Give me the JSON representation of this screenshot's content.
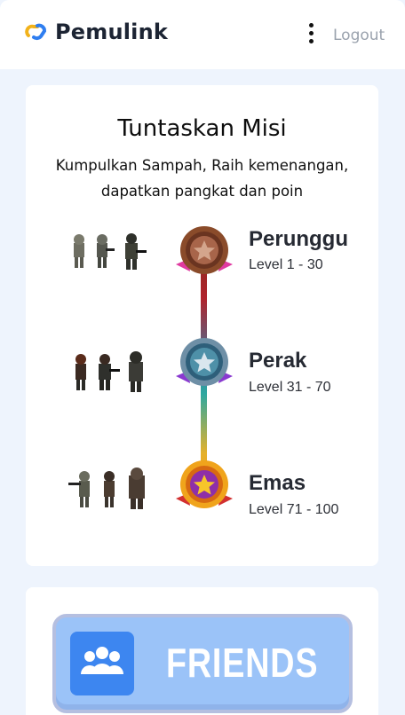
{
  "header": {
    "brand": "Pemulink",
    "logout_label": "Logout"
  },
  "mission": {
    "title": "Tuntaskan Misi",
    "subtitle_line1": "Kumpulkan Sampah, Raih kemenangan,",
    "subtitle_line2": "dapatkan pangkat dan poin",
    "tiers": [
      {
        "name": "Perunggu",
        "range": "Level 1 - 30",
        "color": "#8a4b2a",
        "ribbon": "#e03aa0"
      },
      {
        "name": "Perak",
        "range": "Level 31 - 70",
        "color": "#6e8fa6",
        "ribbon": "#8a3ad0"
      },
      {
        "name": "Emas",
        "range": "Level 71 - 100",
        "color": "#f0a41c",
        "ribbon": "#d23030"
      }
    ]
  },
  "friends": {
    "label": "FRIENDS"
  },
  "colors": {
    "page_bg": "#eef4fd",
    "accent_blue": "#3d86f0",
    "friends_bg": "#9bc3f8"
  }
}
